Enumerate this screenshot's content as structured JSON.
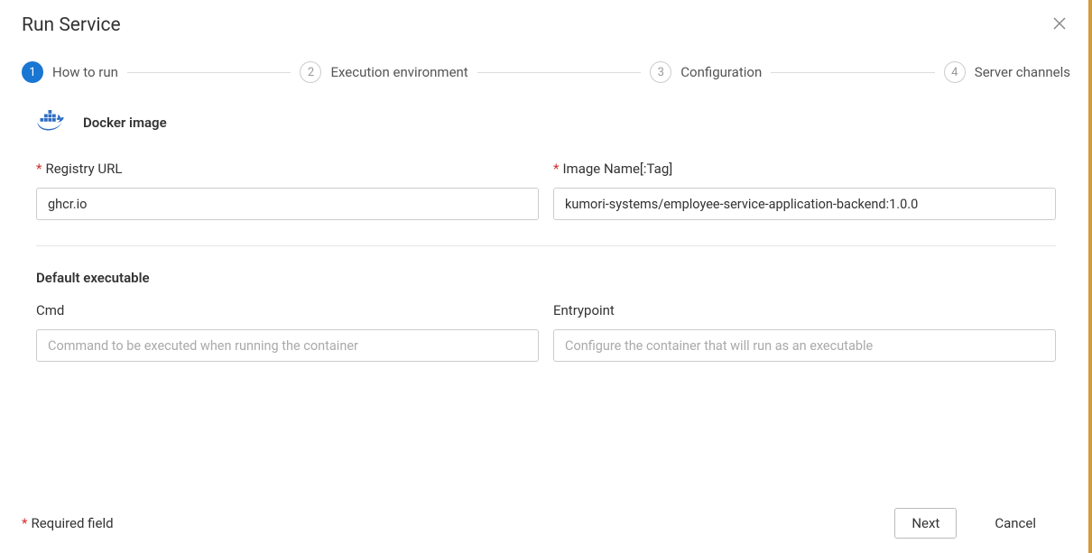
{
  "header": {
    "title": "Run Service"
  },
  "stepper": {
    "steps": [
      {
        "num": "1",
        "label": "How to run",
        "active": true
      },
      {
        "num": "2",
        "label": "Execution environment",
        "active": false
      },
      {
        "num": "3",
        "label": "Configuration",
        "active": false
      },
      {
        "num": "4",
        "label": "Server channels",
        "active": false
      }
    ]
  },
  "docker": {
    "section_title": "Docker image",
    "registry_label": "Registry URL",
    "registry_value": "ghcr.io",
    "image_label": "Image Name[:Tag]",
    "image_value": "kumori-systems/employee-service-application-backend:1.0.0"
  },
  "executable": {
    "section_title": "Default executable",
    "cmd_label": "Cmd",
    "cmd_placeholder": "Command to be executed when running the container",
    "entrypoint_label": "Entrypoint",
    "entrypoint_placeholder": "Configure the container that will run as an executable"
  },
  "footer": {
    "required_note": "Required field",
    "next_label": "Next",
    "cancel_label": "Cancel"
  }
}
